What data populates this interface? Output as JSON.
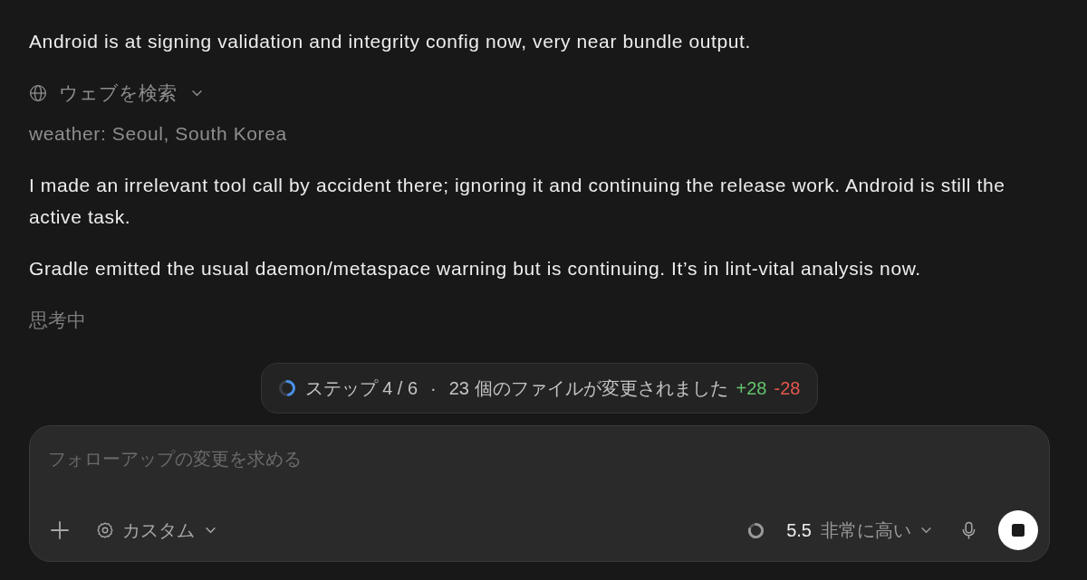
{
  "messages": [
    {
      "kind": "text",
      "text": "Android is at signing validation and integrity config now, very near bundle output."
    },
    {
      "kind": "tool",
      "label": "ウェブを検索",
      "expanded": false
    },
    {
      "kind": "query",
      "text": "weather: Seoul, South Korea"
    },
    {
      "kind": "text",
      "text": "I made an irrelevant tool call by accident there; ignoring it and continuing the release work. Android is still the active task."
    },
    {
      "kind": "text",
      "text": "Gradle emitted the usual daemon/metaspace warning but is continuing. It’s in lint-vital analysis now."
    },
    {
      "kind": "status",
      "text": "思考中"
    }
  ],
  "progress": {
    "step_label": "ステップ 4 / 6",
    "separator": "·",
    "files_label": "23 個のファイルが変更されました",
    "additions": "+28",
    "deletions": "-28"
  },
  "composer": {
    "placeholder": "フォローアップの変更を求める",
    "mode_label": "カスタム",
    "model_version": "5.5",
    "effort_label": "非常に高い"
  }
}
